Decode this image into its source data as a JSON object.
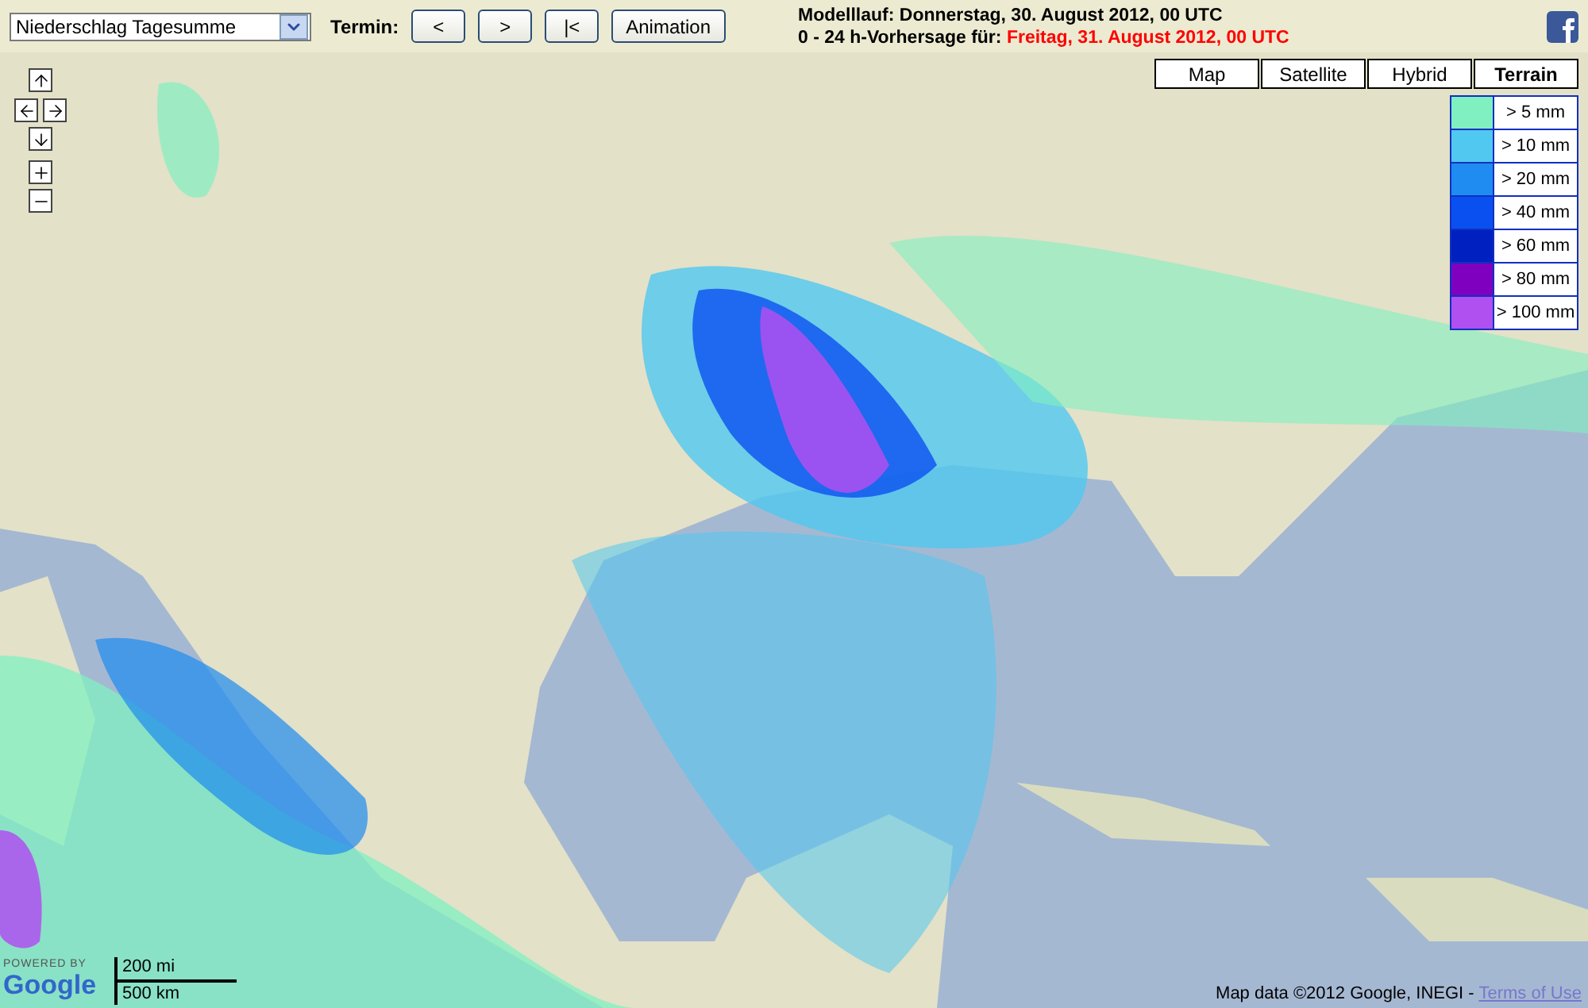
{
  "toolbar": {
    "product_select": {
      "value": "Niederschlag Tagesumme"
    },
    "termin_label": "Termin:",
    "buttons": [
      "<",
      ">",
      "|<",
      "Animation"
    ]
  },
  "run_info": {
    "model_run": "Modelllauf: Donnerstag, 30. August 2012, 00 UTC",
    "forecast_prefix": "0 - 24 h-Vorhersage für:",
    "forecast_date": "Freitag, 31. August 2012, 00 UTC"
  },
  "map": {
    "map_types": [
      {
        "label": "Map",
        "selected": false
      },
      {
        "label": "Satellite",
        "selected": false
      },
      {
        "label": "Hybrid",
        "selected": false
      },
      {
        "label": "Terrain",
        "selected": true
      }
    ],
    "legend": [
      {
        "label": "> 5 mm",
        "color": "#80f0c0"
      },
      {
        "label": "> 10 mm",
        "color": "#50c8f0"
      },
      {
        "label": "> 20 mm",
        "color": "#1e8cf0"
      },
      {
        "label": "> 40 mm",
        "color": "#0a50f0"
      },
      {
        "label": "> 60 mm",
        "color": "#0020c0"
      },
      {
        "label": "> 80 mm",
        "color": "#8000c0"
      },
      {
        "label": "> 100 mm",
        "color": "#b050f0"
      }
    ],
    "logo": {
      "powered_by": "POWERED BY",
      "name": "Google"
    },
    "scale": {
      "miles": "200 mi",
      "kilometers": "500 km"
    },
    "attribution": {
      "text": "Map data ©2012 Google, INEGI - ",
      "link": "Terms of Use"
    }
  }
}
